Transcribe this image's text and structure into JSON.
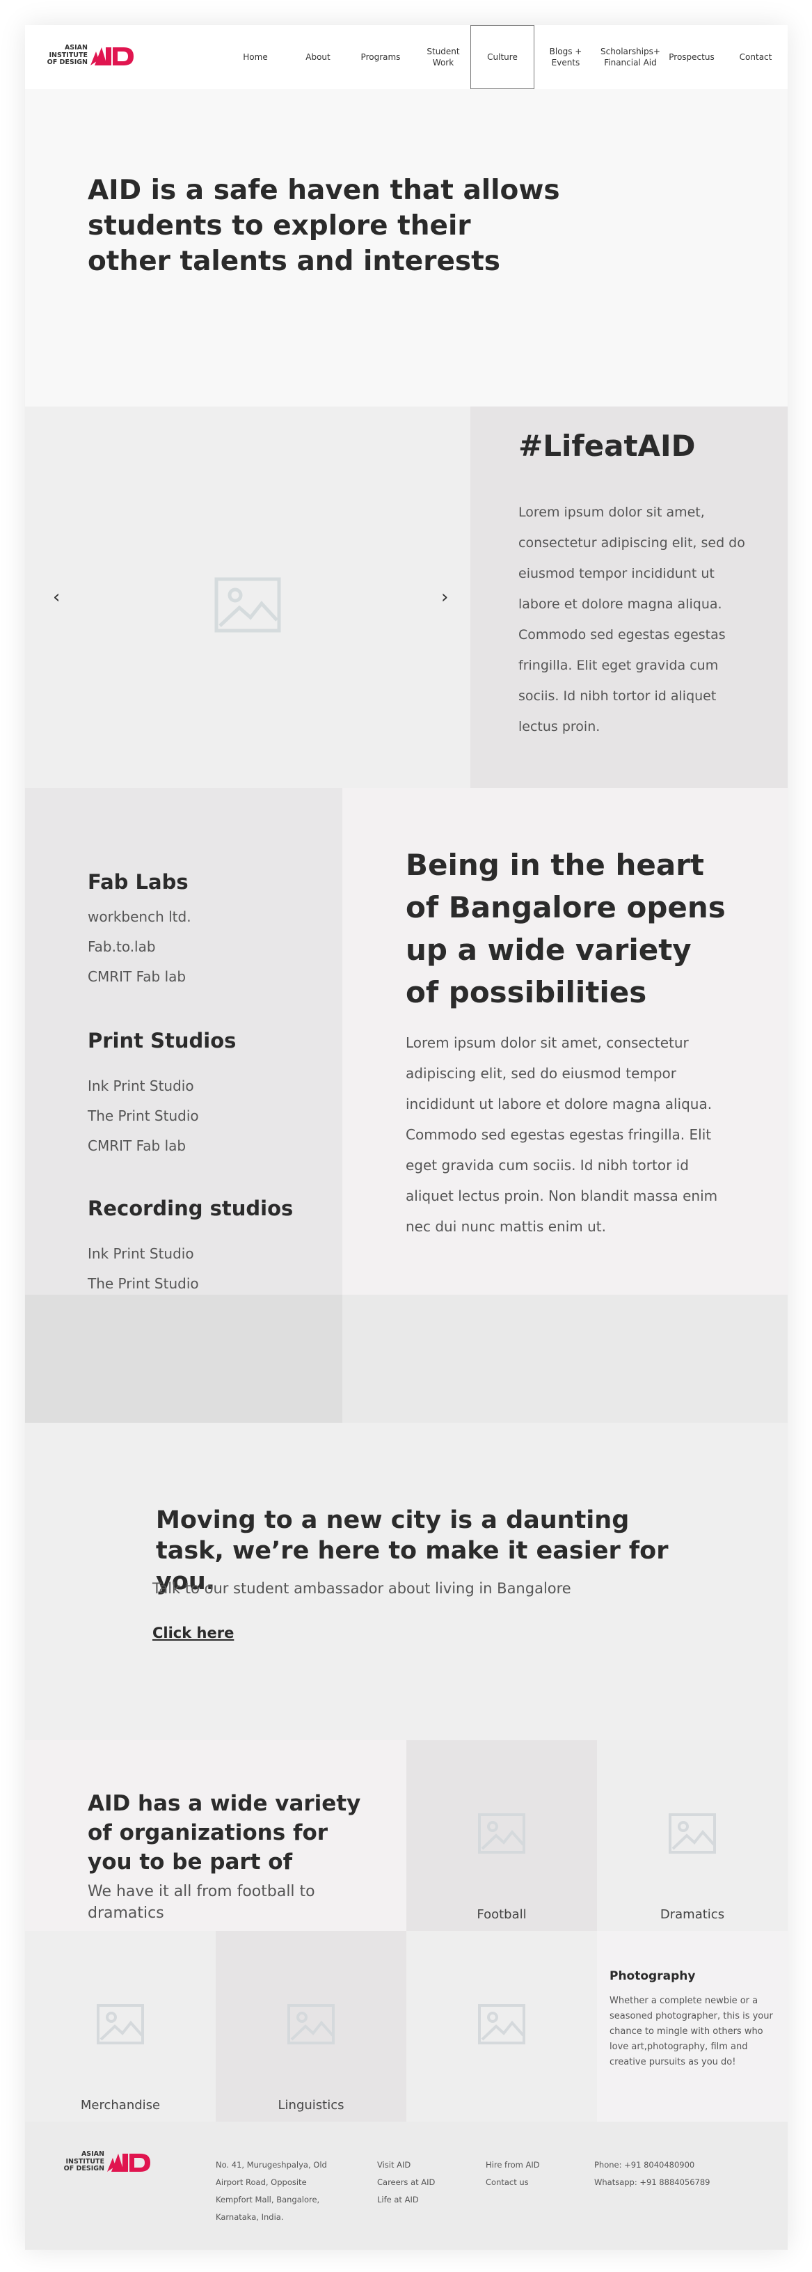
{
  "brand": {
    "logo_text_lines": [
      "ASIAN",
      "INSTITUTE",
      "OF DESIGN"
    ],
    "accent_color": "#e0154f"
  },
  "nav": {
    "items": [
      {
        "label": "Home"
      },
      {
        "label": "About"
      },
      {
        "label": "Programs"
      },
      {
        "label": "Student\nWork"
      },
      {
        "label": "Culture"
      },
      {
        "label": "Blogs +\nEvents"
      },
      {
        "label": "Scholarships+\nFinancial Aid"
      },
      {
        "label": "Prospectus"
      },
      {
        "label": "Contact"
      }
    ],
    "active": "Culture"
  },
  "hero": {
    "title": "AID is a safe haven that allows students to explore their other talents and interests"
  },
  "life": {
    "heading": "#LifeatAID",
    "body": "Lorem ipsum dolor sit amet, consectetur adipiscing elit, sed do eiusmod tempor incididunt ut labore et dolore magna aliqua. Commodo sed egestas egestas fringilla. Elit eget gravida cum sociis. Id nibh tortor id aliquet lectus proin.",
    "carousel": {
      "prev_icon": "chevron-left-icon",
      "next_icon": "chevron-right-icon",
      "image_icon": "image-placeholder-icon"
    }
  },
  "facilities": {
    "groups": [
      {
        "heading": "Fab Labs",
        "items": [
          "workbench ltd.",
          "Fab.to.lab",
          "CMRIT Fab lab"
        ]
      },
      {
        "heading": "Print Studios",
        "items": [
          "Ink Print Studio",
          "The Print Studio",
          "CMRIT Fab lab"
        ]
      },
      {
        "heading": "Recording studios",
        "items": [
          "Ink Print Studio",
          "The Print Studio"
        ]
      }
    ]
  },
  "heart": {
    "heading": "Being in the heart of Bangalore opens up a wide variety of possibilities",
    "body": "Lorem ipsum dolor sit amet, consectetur adipiscing elit, sed do eiusmod tempor incididunt ut labore et dolore magna aliqua. Commodo sed egestas egestas fringilla. Elit eget gravida cum sociis. Id nibh tortor id aliquet lectus proin. Non blandit massa enim nec dui nunc mattis enim ut."
  },
  "ambassador": {
    "heading": "Moving to a new city is a daunting task, we’re here to make it easier for you.",
    "subtext": "Talk to our student ambassador about living in Bangalore",
    "link": "Click here"
  },
  "organizations": {
    "heading": "AID has a wide variety of organizations for you to be part of",
    "subtext": "We have it all from football to dramatics",
    "tiles": [
      "Football",
      "Dramatics",
      "Merchandise",
      "Linguistics",
      ""
    ],
    "photography": {
      "title": "Photography",
      "body": "Whether a complete newbie or a seasoned photographer, this is your chance to mingle with others who love art,photography, film and creative pursuits as you do!"
    }
  },
  "footer": {
    "address": [
      "No. 41, Murugeshpalya, Old",
      "Airport Road, Opposite",
      "Kempfort Mall, Bangalore,",
      "Karnataka, India."
    ],
    "links_a": [
      "Visit AID",
      "Careers at AID",
      "Life at AID"
    ],
    "links_b": [
      "Hire from AID",
      "Contact us"
    ],
    "contact": [
      "Phone: +91 8040480900",
      "Whatsapp: +91 8884056789"
    ]
  }
}
